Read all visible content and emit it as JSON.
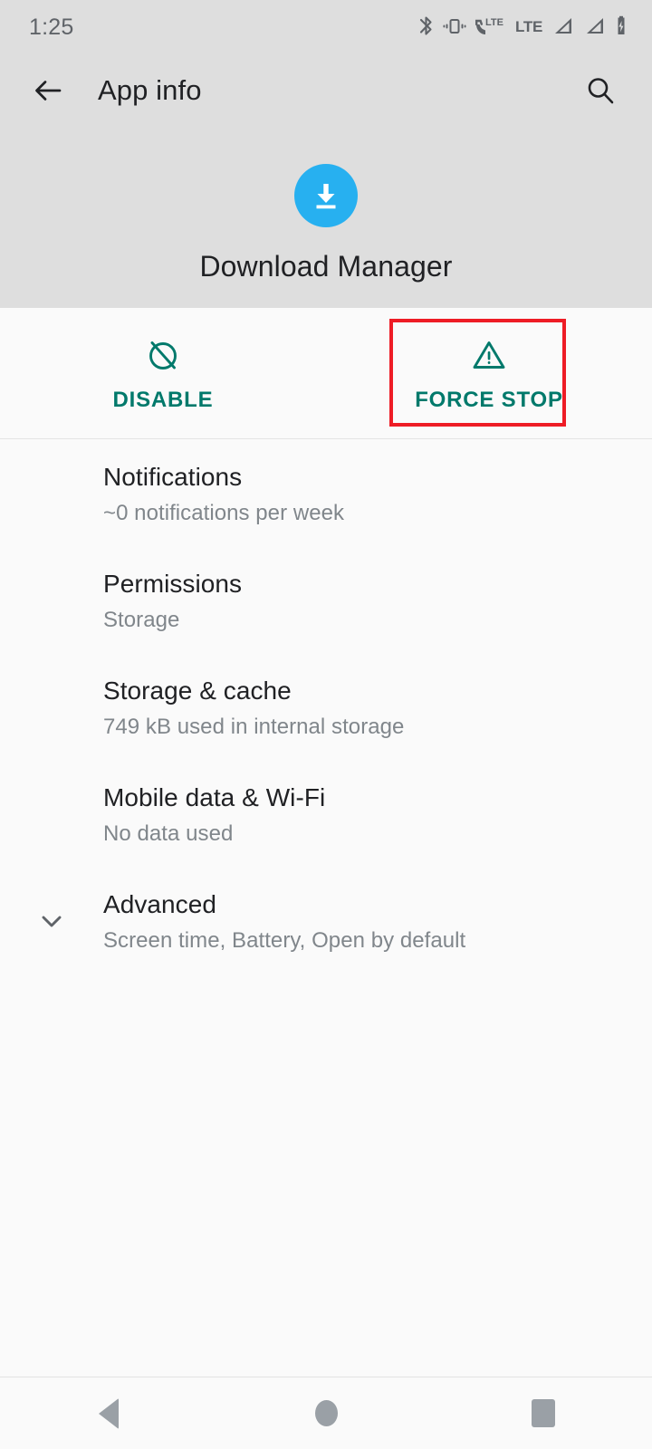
{
  "status_bar": {
    "time": "1:25",
    "icons": [
      {
        "name": "bluetooth-icon"
      },
      {
        "name": "vibrate-icon"
      },
      {
        "name": "volte-call-icon",
        "label": "LTE"
      },
      {
        "name": "lte-network-icon",
        "label": "LTE"
      },
      {
        "name": "signal-bars-sim1-icon"
      },
      {
        "name": "signal-bars-sim2-icon"
      },
      {
        "name": "battery-charging-icon"
      }
    ]
  },
  "app_bar": {
    "back_label": "Back",
    "title": "App info",
    "search_label": "Search"
  },
  "app_header": {
    "app_name": "Download Manager",
    "icon_name": "download-manager-icon",
    "icon_color": "#27b0f0"
  },
  "actions": {
    "accent_color": "#00796b",
    "highlight_color": "#ee1c25",
    "buttons": [
      {
        "label": "DISABLE",
        "icon": "block-circle-slash-icon",
        "highlighted": false
      },
      {
        "label": "FORCE STOP",
        "icon": "warning-triangle-icon",
        "highlighted": true
      }
    ]
  },
  "settings_list": [
    {
      "title": "Notifications",
      "subtitle": "~0 notifications per week",
      "expand_icon": ""
    },
    {
      "title": "Permissions",
      "subtitle": "Storage",
      "expand_icon": ""
    },
    {
      "title": "Storage & cache",
      "subtitle": "749 kB used in internal storage",
      "expand_icon": ""
    },
    {
      "title": "Mobile data & Wi-Fi",
      "subtitle": "No data used",
      "expand_icon": ""
    },
    {
      "title": "Advanced",
      "subtitle": "Screen time, Battery, Open by default",
      "expand_icon": "chevron-down-icon"
    }
  ],
  "nav_bar": {
    "back_label": "Back",
    "home_label": "Home",
    "recents_label": "Recents"
  }
}
